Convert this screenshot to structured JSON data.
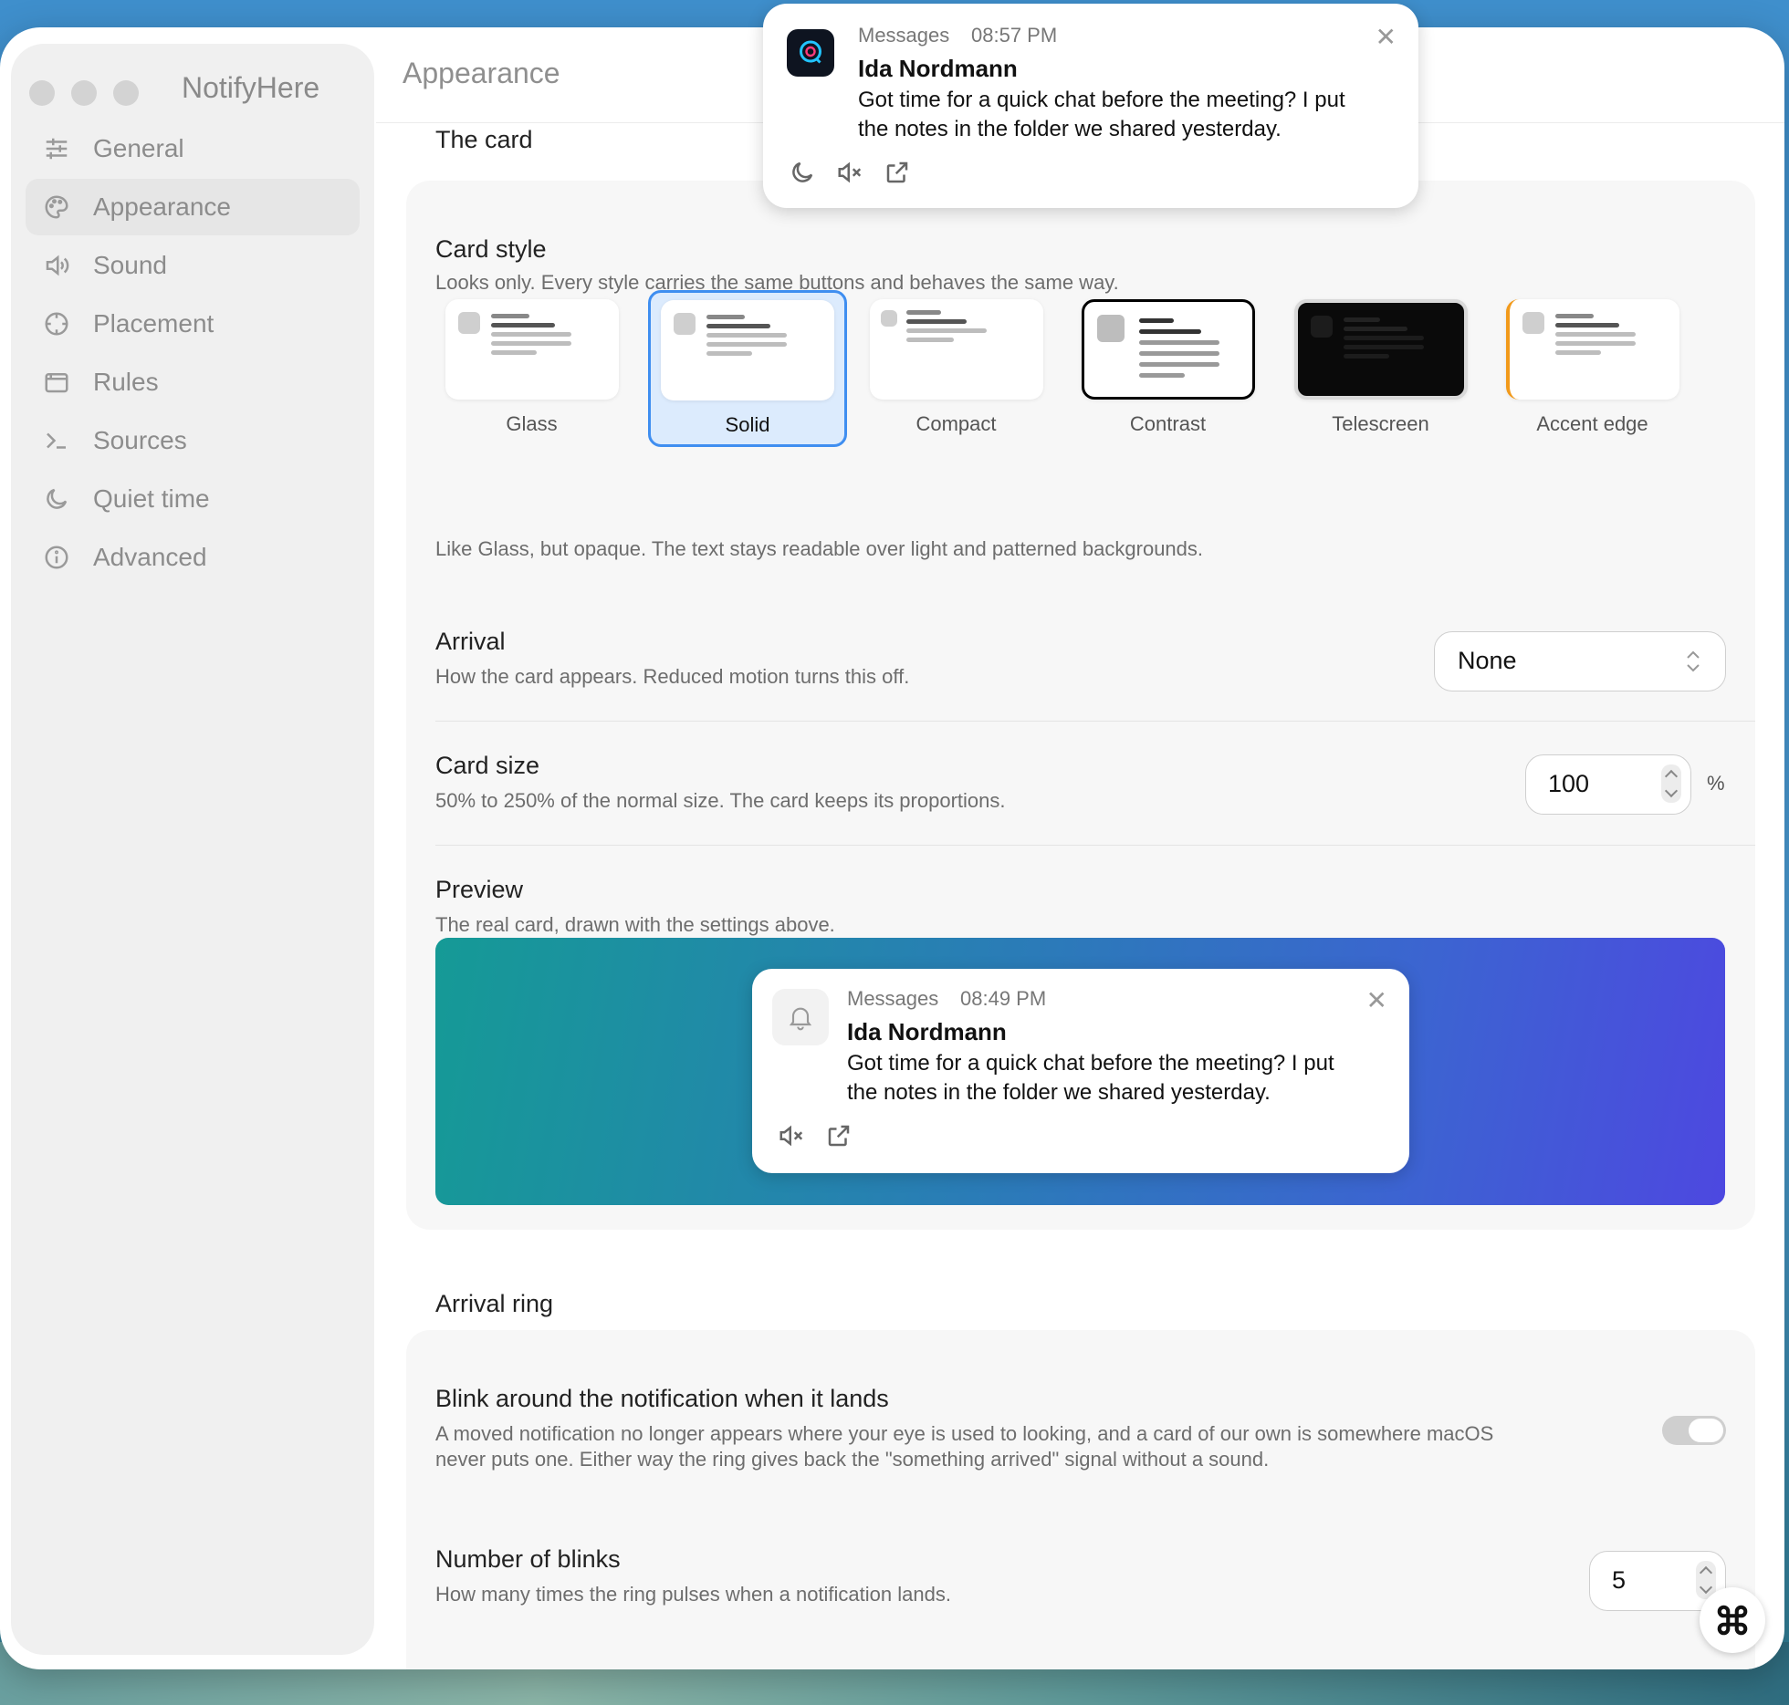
{
  "app": {
    "title": "NotifyHere"
  },
  "sidebar": {
    "items": [
      {
        "label": "General",
        "icon": "sliders-icon"
      },
      {
        "label": "Appearance",
        "icon": "palette-icon",
        "active": true
      },
      {
        "label": "Sound",
        "icon": "speaker-icon"
      },
      {
        "label": "Placement",
        "icon": "crosshair-icon"
      },
      {
        "label": "Rules",
        "icon": "window-icon"
      },
      {
        "label": "Sources",
        "icon": "terminal-icon"
      },
      {
        "label": "Quiet time",
        "icon": "moon-icon"
      },
      {
        "label": "Advanced",
        "icon": "info-icon"
      }
    ]
  },
  "main": {
    "title": "Appearance"
  },
  "the_card": {
    "section_title": "The card",
    "card_style": {
      "title": "Card style",
      "desc": "Looks only. Every style carries the same buttons and behaves the same way.",
      "options": [
        "Glass",
        "Solid",
        "Compact",
        "Contrast",
        "Telescreen",
        "Accent edge"
      ],
      "selected": "Solid",
      "selected_desc": "Like Glass, but opaque. The text stays readable over light and patterned backgrounds."
    },
    "arrival": {
      "title": "Arrival",
      "desc": "How the card appears. Reduced motion turns this off.",
      "value": "None"
    },
    "card_size": {
      "title": "Card size",
      "desc": "50% to 250% of the normal size. The card keeps its proportions.",
      "value": "100",
      "unit": "%"
    },
    "preview": {
      "title": "Preview",
      "desc": "The real card, drawn with the settings above.",
      "card": {
        "app": "Messages",
        "time": "08:49 PM",
        "sender": "Ida Nordmann",
        "line1": "Got time for a quick chat before the meeting? I put",
        "line2": "the notes in the folder we shared yesterday."
      }
    }
  },
  "arrival_ring": {
    "section_title": "Arrival ring",
    "blink": {
      "title": "Blink around the notification when it lands",
      "desc1": "A moved notification no longer appears where your eye is used to looking, and a card of our own is somewhere macOS",
      "desc2": "never puts one. Either way the ring gives back the \"something arrived\" signal without a sound.",
      "enabled": false
    },
    "blinks": {
      "title": "Number of blinks",
      "desc": "How many times the ring pulses when a notification lands.",
      "value": "5"
    }
  },
  "toast": {
    "app": "Messages",
    "time": "08:57 PM",
    "sender": "Ida Nordmann",
    "line1": "Got time for a quick chat before the meeting? I put",
    "line2": "the notes in the folder we shared yesterday."
  },
  "colors": {
    "accent": "#3f8ef0",
    "selected_bg": "#dcebfd"
  }
}
